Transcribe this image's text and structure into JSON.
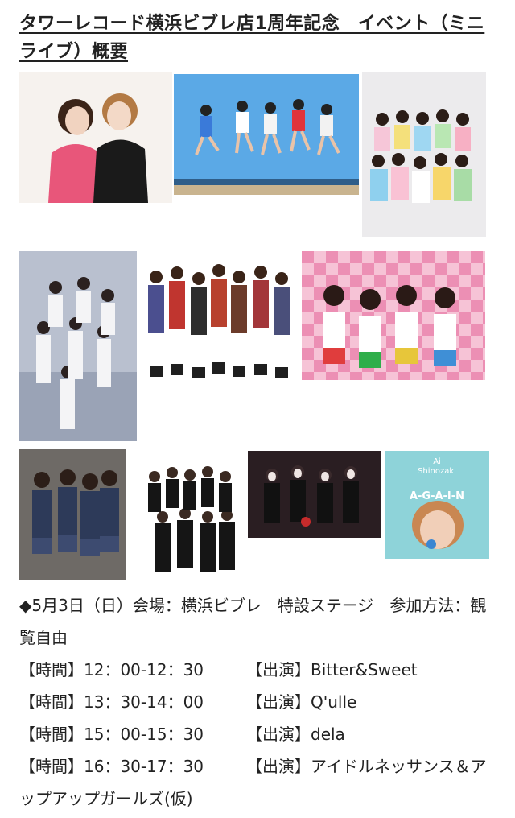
{
  "title": "タワーレコード横浜ビブレ店1周年記念　イベント（ミニライブ）概要",
  "images": [
    {
      "name": "photo-duo-singers"
    },
    {
      "name": "photo-jumping-group-beach"
    },
    {
      "name": "photo-large-idol-group"
    },
    {
      "name": "photo-white-outfit-group"
    },
    {
      "name": "photo-plaid-outfit-group"
    },
    {
      "name": "photo-pink-checker-group"
    },
    {
      "name": "photo-school-uniform-group"
    },
    {
      "name": "photo-black-white-group"
    },
    {
      "name": "photo-dark-stage-group"
    },
    {
      "name": "photo-album-cover",
      "text_lines": [
        "Ai",
        "Shinozaki",
        "A-G-A-I-N"
      ]
    }
  ],
  "event": {
    "intro": "◆5月3日（日）会場：横浜ビブレ　特設ステージ　参加方法：観覧自由",
    "schedule": [
      {
        "time": "【時間】12：00-12：30",
        "performer": "【出演】Bitter&Sweet"
      },
      {
        "time": "【時間】13：30-14：00",
        "performer": "【出演】Q'ulle"
      },
      {
        "time": "【時間】15：00-15：30",
        "performer": "【出演】dela"
      },
      {
        "time": "【時間】16：30-17：30",
        "performer": "【出演】アイドルネッサンス＆アップアップガールズ(仮)"
      }
    ]
  }
}
